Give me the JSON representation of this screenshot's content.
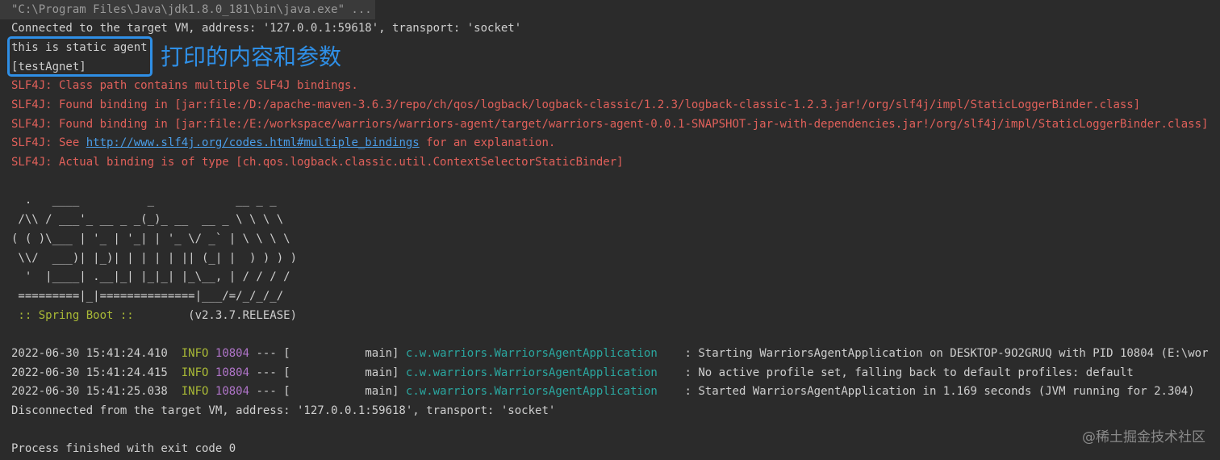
{
  "console": {
    "command": "\"C:\\Program Files\\Java\\jdk1.8.0_181\\bin\\java.exe\" ...",
    "connected": "Connected to the target VM, address: '127.0.0.1:59618', transport: 'socket'",
    "agent_output": [
      "this is static agent",
      "[testAgnet]"
    ],
    "annotation": "打印的内容和参数",
    "slf4j": [
      "SLF4J: Class path contains multiple SLF4J bindings.",
      "SLF4J: Found binding in [jar:file:/D:/apache-maven-3.6.3/repo/ch/qos/logback/logback-classic/1.2.3/logback-classic-1.2.3.jar!/org/slf4j/impl/StaticLoggerBinder.class]",
      "SLF4J: Found binding in [jar:file:/E:/workspace/warriors/warriors-agent/target/warriors-agent-0.0.1-SNAPSHOT-jar-with-dependencies.jar!/org/slf4j/impl/StaticLoggerBinder.class]"
    ],
    "slf4j_see": {
      "prefix": "SLF4J: See ",
      "link": "http://www.slf4j.org/codes.html#multiple_bindings",
      "suffix": " for an explanation."
    },
    "slf4j_actual": "SLF4J: Actual binding is of type [ch.qos.logback.classic.util.ContextSelectorStaticBinder]",
    "banner": [
      "  .   ____          _            __ _ _",
      " /\\\\ / ___'_ __ _ _(_)_ __  __ _ \\ \\ \\ \\",
      "( ( )\\___ | '_ | '_| | '_ \\/ _` | \\ \\ \\ \\",
      " \\\\/  ___)| |_)| | | | | || (_| |  ) ) ) )",
      "  '  |____| .__|_| |_|_| |_\\__, | / / / /",
      " =========|_|==============|___/=/_/_/_/"
    ],
    "spring_label": " :: Spring Boot ::",
    "spring_version": "        (v2.3.7.RELEASE)",
    "logs": [
      {
        "timestamp": "2022-06-30 15:41:24.410",
        "level": "INFO",
        "pid": "10804",
        "sep": " --- [",
        "thread": "           main]",
        "logger": "c.w.warriors.WarriorsAgentApplication",
        "message": ": Starting WarriorsAgentApplication on DESKTOP-9O2GRUQ with PID 10804 (E:\\wor"
      },
      {
        "timestamp": "2022-06-30 15:41:24.415",
        "level": "INFO",
        "pid": "10804",
        "sep": " --- [",
        "thread": "           main]",
        "logger": "c.w.warriors.WarriorsAgentApplication",
        "message": ": No active profile set, falling back to default profiles: default"
      },
      {
        "timestamp": "2022-06-30 15:41:25.038",
        "level": "INFO",
        "pid": "10804",
        "sep": " --- [",
        "thread": "           main]",
        "logger": "c.w.warriors.WarriorsAgentApplication",
        "message": ": Started WarriorsAgentApplication in 1.169 seconds (JVM running for 2.304)"
      }
    ],
    "disconnected": "Disconnected from the target VM, address: '127.0.0.1:59618', transport: 'socket'",
    "finished": "Process finished with exit code 0",
    "watermark": "@稀土掘金技术社区"
  },
  "colors": {
    "background": "#2b2b2b",
    "error_text": "#e0605a",
    "link": "#4a9de8",
    "info_level": "#a9b936",
    "pid": "#b075c9",
    "logger": "#2aa7a0",
    "annotation": "#2f8fe6"
  }
}
